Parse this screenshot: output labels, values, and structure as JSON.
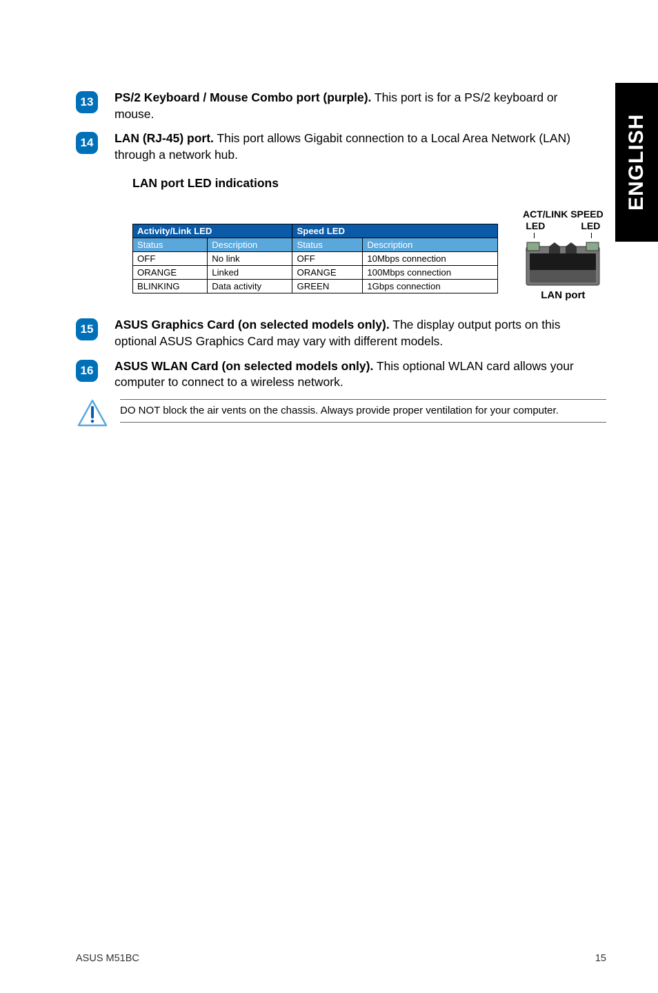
{
  "sideTab": "ENGLISH",
  "items": {
    "i13": {
      "num": "13",
      "bold": "PS/2 Keyboard / Mouse Combo port (purple).",
      "rest": " This port is for a PS/2 keyboard or mouse."
    },
    "i14": {
      "num": "14",
      "bold": "LAN (RJ-45) port.",
      "rest": " This port allows Gigabit connection to a Local Area Network (LAN) through a network hub."
    },
    "i15": {
      "num": "15",
      "bold": "ASUS Graphics Card (on selected models only).",
      "rest": " The display output ports on this optional ASUS Graphics Card may vary with different models."
    },
    "i16": {
      "num": "16",
      "bold": "ASUS WLAN Card (on selected models only).",
      "rest": " This optional WLAN card allows your computer to connect to a wireless network."
    }
  },
  "lanTitle": "LAN port LED indications",
  "ledTop": {
    "line1": "ACT/LINK",
    "line2": "LED",
    "line3": "SPEED",
    "line4": "LED"
  },
  "lanPortLabel": "LAN port",
  "table": {
    "head1a": "Activity/Link LED",
    "head1b": "Speed LED",
    "head2": [
      "Status",
      "Description",
      "Status",
      "Description"
    ],
    "rows": [
      [
        "OFF",
        "No link",
        "OFF",
        "10Mbps connection"
      ],
      [
        "ORANGE",
        "Linked",
        "ORANGE",
        "100Mbps connection"
      ],
      [
        "BLINKING",
        "Data activity",
        "GREEN",
        "1Gbps connection"
      ]
    ]
  },
  "caution": "DO NOT block the air vents on the chassis. Always provide proper ventilation for your computer.",
  "footer": {
    "left": "ASUS M51BC",
    "right": "15"
  }
}
